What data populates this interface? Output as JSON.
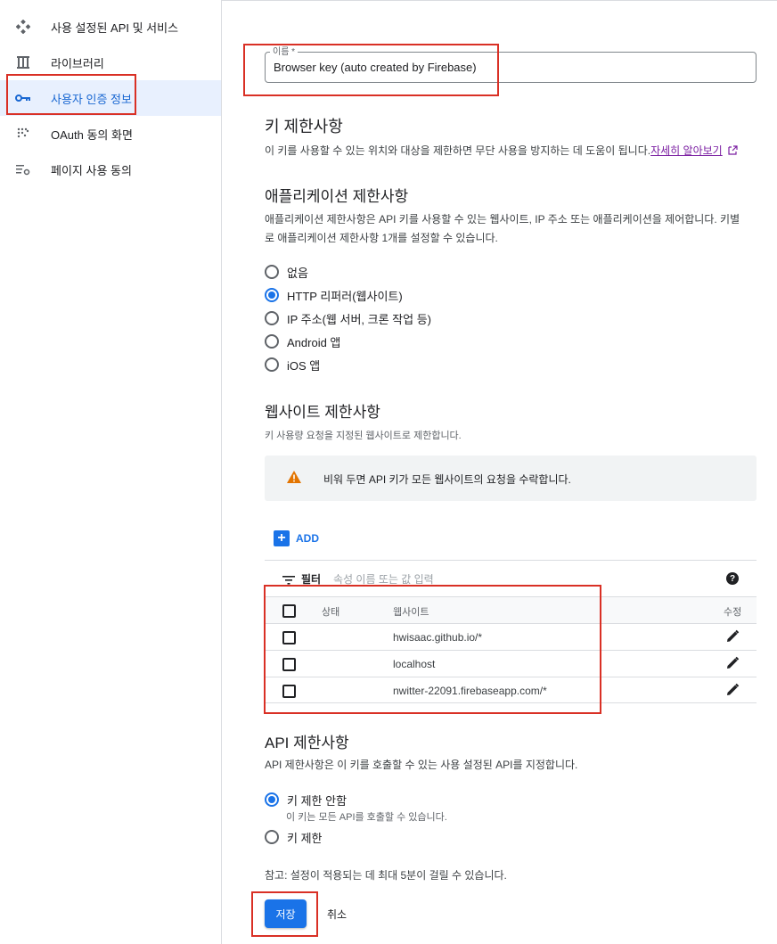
{
  "sidebar": {
    "items": [
      {
        "label": "사용 설정된 API 및 서비스",
        "icon": "api-diamond-icon"
      },
      {
        "label": "라이브러리",
        "icon": "library-icon"
      },
      {
        "label": "사용자 인증 정보",
        "icon": "key-icon",
        "active": true
      },
      {
        "label": "OAuth 동의 화면",
        "icon": "oauth-dots-icon"
      },
      {
        "label": "페이지 사용 동의",
        "icon": "settings-list-icon"
      }
    ]
  },
  "form": {
    "name_label": "이름 *",
    "name_value": "Browser key (auto created by Firebase)",
    "key_restrictions_title": "키 제한사항",
    "key_restrictions_desc": "이 키를 사용할 수 있는 위치와 대상을 제한하면 무단 사용을 방지하는 데 도움이 됩니다.",
    "learn_more": "자세히 알아보기",
    "app_restrictions_title": "애플리케이션 제한사항",
    "app_restrictions_desc_1": "애플리케이션 제한사항은 API 키를 사용할 수 있는 웹사이트, IP 주소 또는 애플리케이션을 제어합니다. 키별",
    "app_restrictions_desc_2": "로 애플리케이션 제한사항 1개를 설정할 수 있습니다.",
    "app_options": [
      "없음",
      "HTTP 리퍼러(웹사이트)",
      "IP 주소(웹 서버, 크론 작업 등)",
      "Android 앱",
      "iOS 앱"
    ],
    "app_selected_index": 1,
    "website_restrictions_title": "웹사이트 제한사항",
    "website_restrictions_desc": "키 사용량 요청을 지정된 웹사이트로 제한합니다.",
    "warning_text": "비워 두면 API 키가 모든 웹사이트의 요청을 수락합니다.",
    "add_label": "ADD",
    "filter_label": "필터",
    "filter_placeholder": "속성 이름 또는 값 입력",
    "table_headers": {
      "status": "상태",
      "website": "웹사이트",
      "edit": "수정"
    },
    "websites": [
      "hwisaac.github.io/*",
      "localhost",
      "nwitter-22091.firebaseapp.com/*"
    ],
    "api_restrictions_title": "API 제한사항",
    "api_restrictions_desc": "API 제한사항은 이 키를 호출할 수 있는 사용 설정된 API를 지정합니다.",
    "api_option_1": "키 제한 안함",
    "api_option_1_sub": "이 키는 모든 API를 호출할 수 있습니다.",
    "api_option_2": "키 제한",
    "note": "참고: 설정이 적용되는 데 최대 5분이 걸릴 수 있습니다.",
    "save_label": "저장",
    "cancel_label": "취소"
  },
  "colors": {
    "accent": "#1a73e8",
    "highlight_border": "#d93025",
    "warning": "#e37400"
  }
}
